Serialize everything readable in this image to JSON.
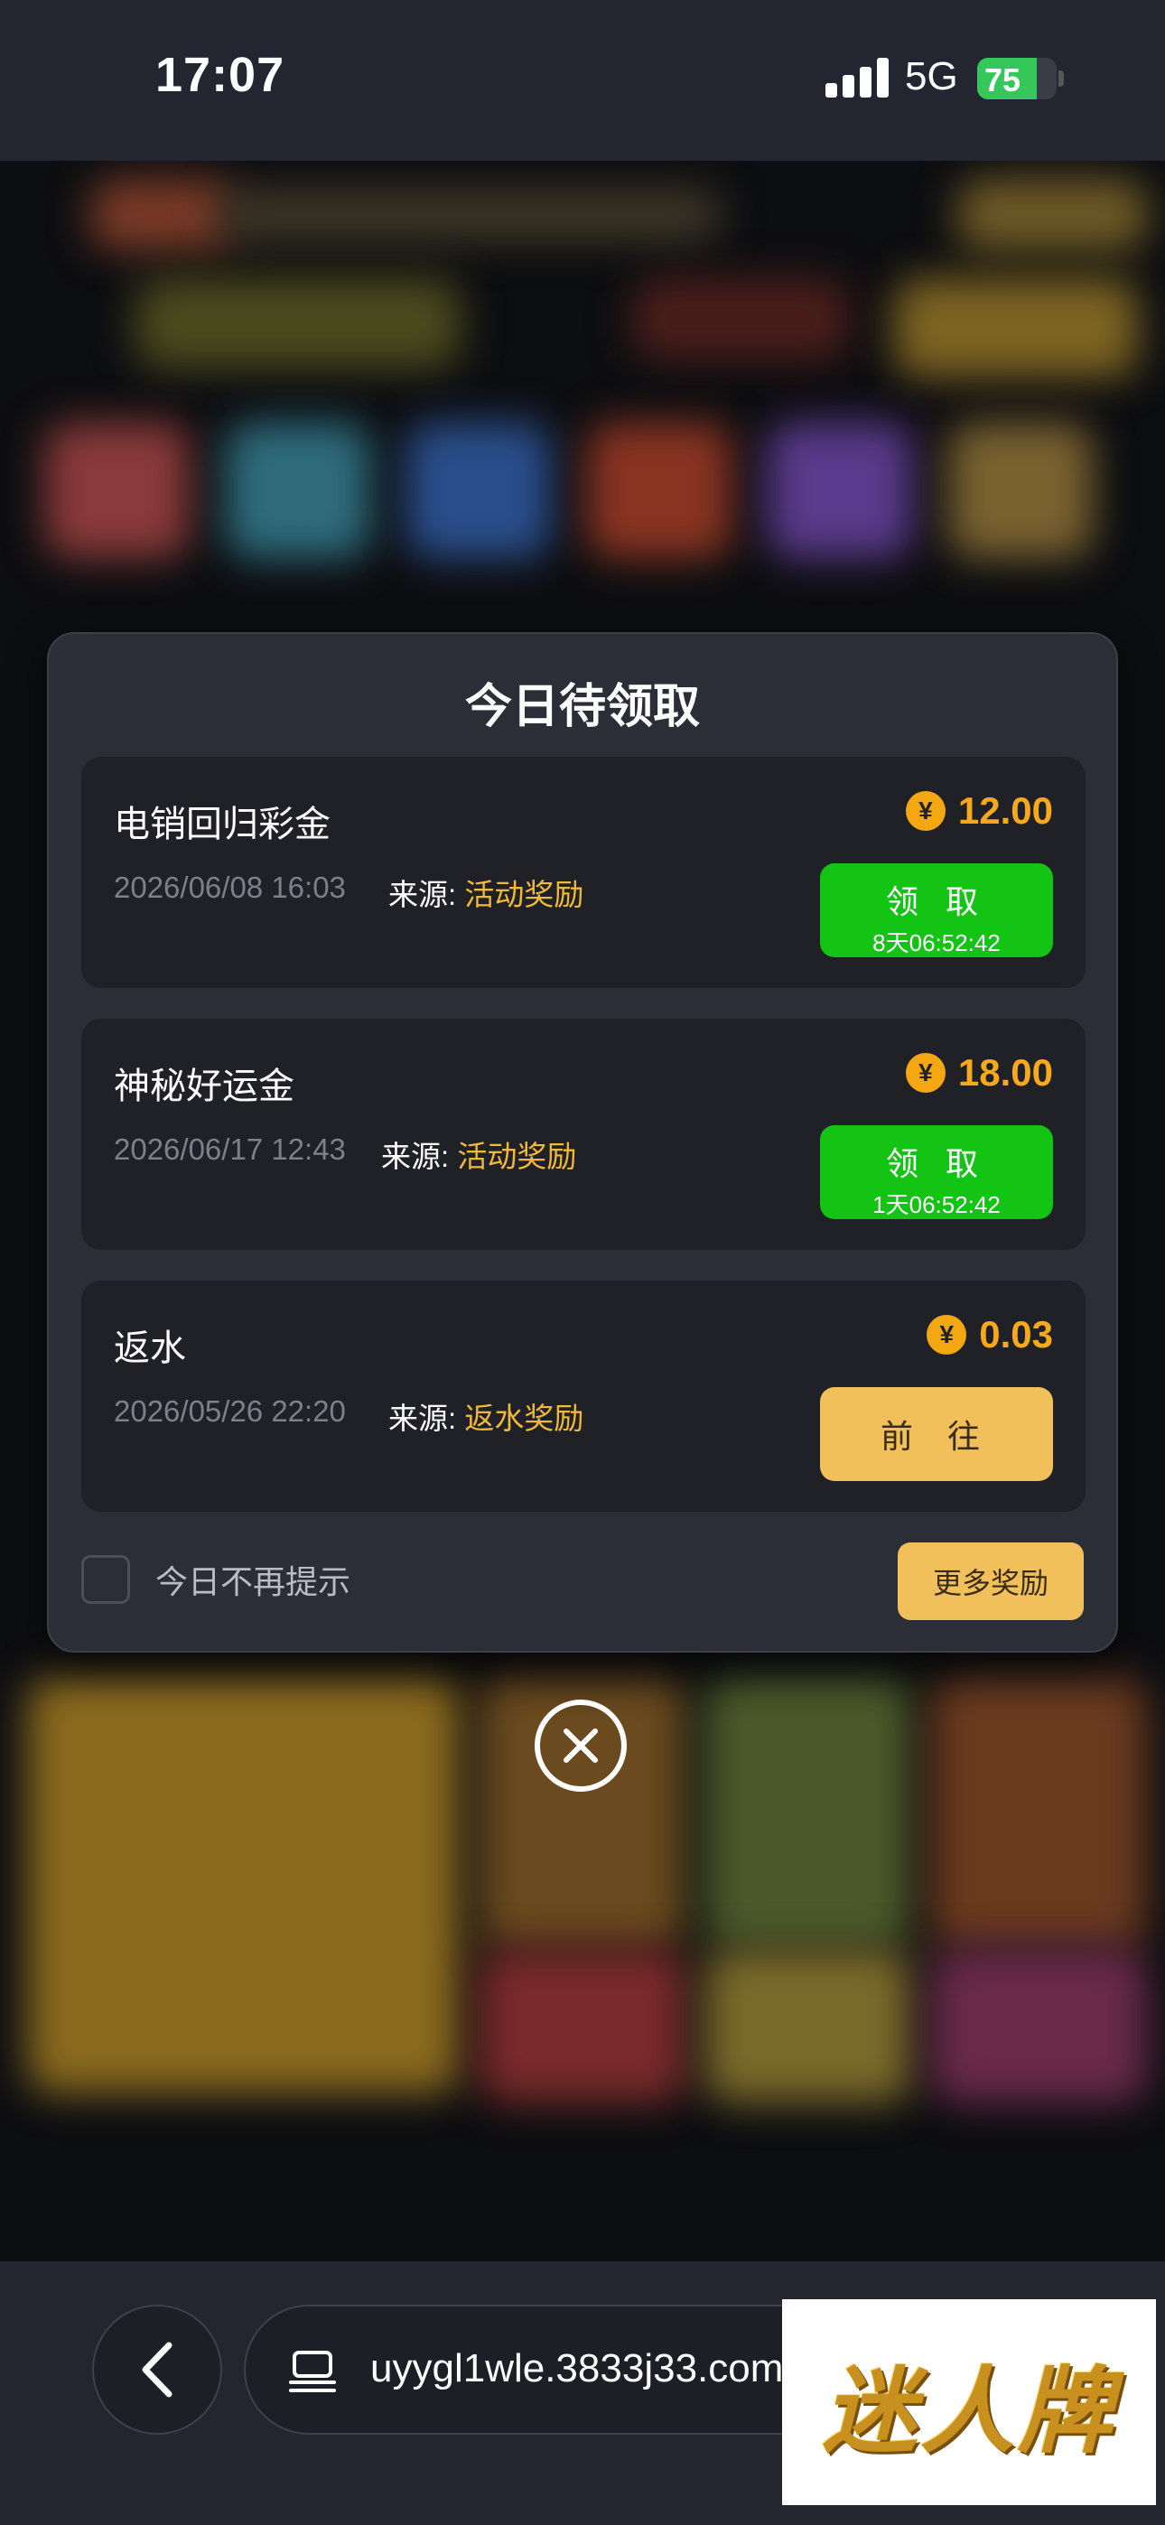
{
  "status_bar": {
    "time": "17:07",
    "network": "5G",
    "battery": "75",
    "battery_level": 0.75
  },
  "modal": {
    "title": "今日待领取",
    "items": [
      {
        "name": "电销回归彩金",
        "date": "2026/06/08 16:03",
        "source_label": "来源:",
        "source": "活动奖励",
        "amount": "12.00",
        "button": "领 取",
        "countdown": "8天06:52:42"
      },
      {
        "name": "神秘好运金",
        "date": "2026/06/17 12:43",
        "source_label": "来源:",
        "source": "活动奖励",
        "amount": "18.00",
        "button": "领 取",
        "countdown": "1天06:52:42"
      },
      {
        "name": "返水",
        "date": "2026/05/26 22:20",
        "source_label": "来源:",
        "source": "返水奖励",
        "amount": "0.03",
        "button": "前 往"
      }
    ],
    "dont_show_label": "今日不再提示",
    "more_rewards": "更多奖励",
    "coin_symbol": "¥"
  },
  "browser": {
    "url": "uyygl1wle.3833j33.com"
  },
  "watermark": {
    "text": "迷人牌"
  },
  "colors": {
    "claim_green": "#14c414",
    "gold": "#f2c05a",
    "amount_orange": "#f7a81b",
    "source_gold": "#f0b93b"
  },
  "icons": [
    "close-circle-icon",
    "back-chevron-icon",
    "tab-icon",
    "yen-coin-icon"
  ]
}
